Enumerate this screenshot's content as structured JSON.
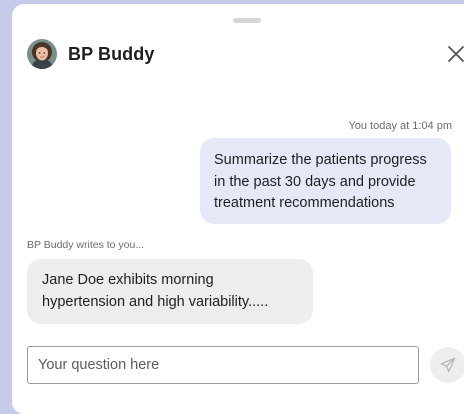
{
  "header": {
    "title": "BP Buddy",
    "avatar_icon": "woman-avatar-icon",
    "close_icon": "close-icon"
  },
  "messages": {
    "user": {
      "timestamp": "You today at 1:04 pm",
      "text": "Summarize the patients progress in the past 30 days and provide treatment recommendations"
    },
    "bot": {
      "label": "BP Buddy writes to you...",
      "text": "Jane Doe exhibits morning hypertension and high variability....."
    }
  },
  "composer": {
    "placeholder": "Your question here",
    "value": "",
    "send_icon": "send-icon"
  },
  "colors": {
    "backdrop": "#c5cbe9",
    "user_bubble": "#e5e8f6",
    "bot_bubble": "#ededed"
  }
}
